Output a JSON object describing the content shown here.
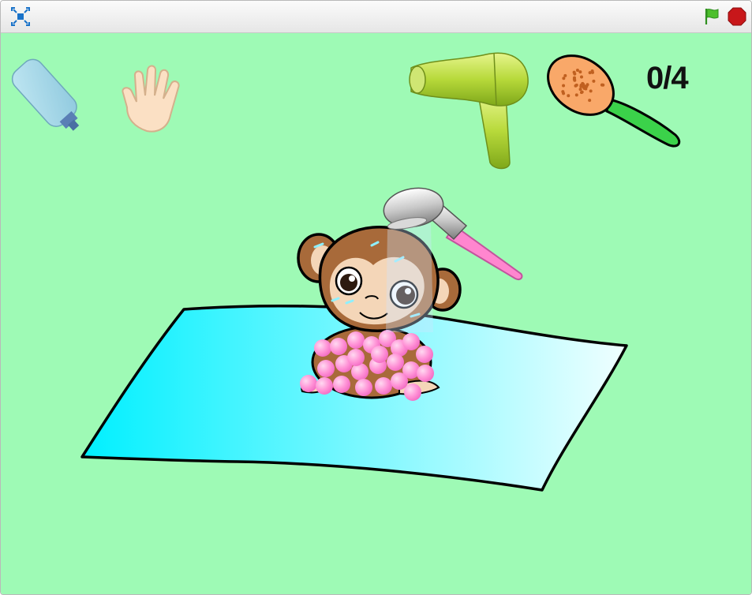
{
  "toolbar": {
    "fullscreen_icon": "fullscreen-icon",
    "green_flag_icon": "green-flag-icon",
    "stop_icon": "stop-sign-icon"
  },
  "stage": {
    "score": "0/4",
    "background_color": "#9efab5",
    "tools": [
      "shampoo-bottle",
      "hand",
      "hair-dryer",
      "brush",
      "shower-head"
    ],
    "character": "monkey",
    "towel_colors": [
      "#00f0ff",
      "#f0ffff"
    ]
  }
}
